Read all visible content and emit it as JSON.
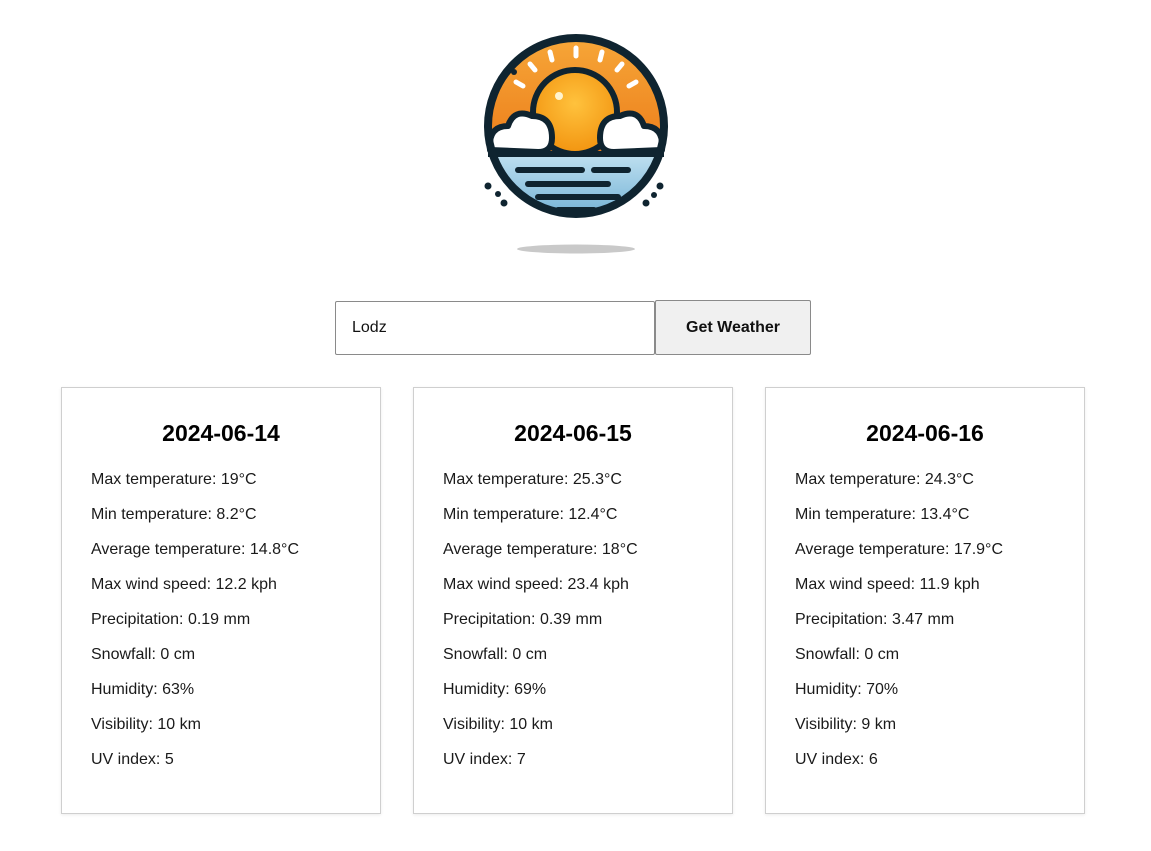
{
  "logo": {
    "icon": "sun-over-sea-logo",
    "colors": {
      "outline": "#0f2430",
      "sun": "#f7a21a",
      "sky": "#f08a1c",
      "sea": "#8cc4e0",
      "cloud": "#ffffff"
    }
  },
  "search": {
    "value": "Lodz",
    "placeholder": "",
    "button_label": "Get Weather"
  },
  "forecast": [
    {
      "date": "2024-06-14",
      "max_temp": "Max temperature: 19°C",
      "min_temp": "Min temperature: 8.2°C",
      "avg_temp": "Average temperature: 14.8°C",
      "max_wind": "Max wind speed: 12.2 kph",
      "precip": "Precipitation: 0.19 mm",
      "snow": "Snowfall: 0 cm",
      "humidity": "Humidity: 63%",
      "visibility": "Visibility: 10 km",
      "uv": "UV index: 5"
    },
    {
      "date": "2024-06-15",
      "max_temp": "Max temperature: 25.3°C",
      "min_temp": "Min temperature: 12.4°C",
      "avg_temp": "Average temperature: 18°C",
      "max_wind": "Max wind speed: 23.4 kph",
      "precip": "Precipitation: 0.39 mm",
      "snow": "Snowfall: 0 cm",
      "humidity": "Humidity: 69%",
      "visibility": "Visibility: 10 km",
      "uv": "UV index: 7"
    },
    {
      "date": "2024-06-16",
      "max_temp": "Max temperature: 24.3°C",
      "min_temp": "Min temperature: 13.4°C",
      "avg_temp": "Average temperature: 17.9°C",
      "max_wind": "Max wind speed: 11.9 kph",
      "precip": "Precipitation: 3.47 mm",
      "snow": "Snowfall: 0 cm",
      "humidity": "Humidity: 70%",
      "visibility": "Visibility: 9 km",
      "uv": "UV index: 6"
    }
  ]
}
